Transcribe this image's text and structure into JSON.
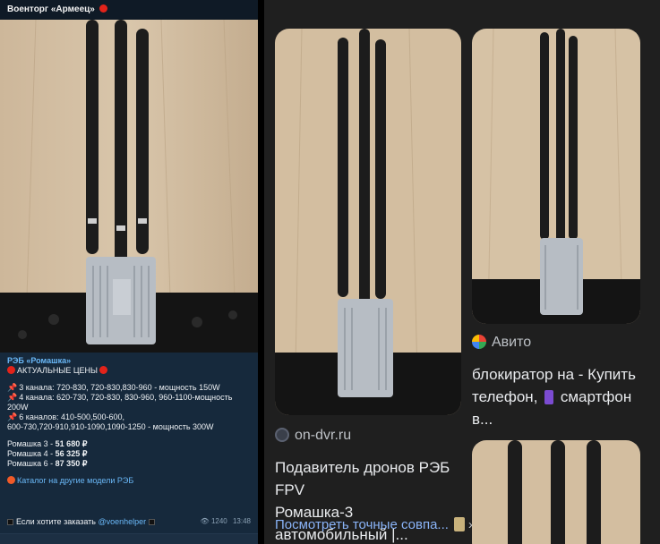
{
  "telegram": {
    "channel_name": "Военторг «Армеец»",
    "post": {
      "title": "РЭБ «Ромашка»",
      "actual_prices": "АКТУАЛЬНЫЕ ЦЕНЫ",
      "line_3ch": "3 канала: 720-830, 720-830,830-960 - мощность 150W",
      "line_4ch_a": "4 канала: 620-730, 720-830, 830-960, 960-1100-мощность",
      "line_4ch_b": "200W",
      "line_6ch_a": "6 каналов: 410-500,500-600,",
      "line_6ch_b": "600-730,720-910,910-1090,1090-1250 - мощность 300W",
      "price3_label": "Ромашка 3 - ",
      "price3_value": "51 680 ₽",
      "price4_label": "Ромашка 4 - ",
      "price4_value": "56 325 ₽",
      "price6_label": "Ромашка 6 - ",
      "price6_value": "87 350 ₽",
      "catalog_link": "Каталог на другие модели РЭБ",
      "order_prefix": "Если хотите заказать ",
      "order_handle": "@voenhelper",
      "views": "1240",
      "time": "13:48"
    }
  },
  "search": {
    "result1": {
      "source": "on-dvr.ru",
      "title_l1": "Подавитель дронов РЭБ FPV",
      "title_l2": "Ромашка-3 автомобильный |...",
      "more_link": "Посмотреть точные совпа..."
    },
    "result2": {
      "source": "Авито",
      "title_l1": "блокиратор на - Купить",
      "title_l2a": "телефон, ",
      "title_l2b": " смартфон в..."
    }
  }
}
